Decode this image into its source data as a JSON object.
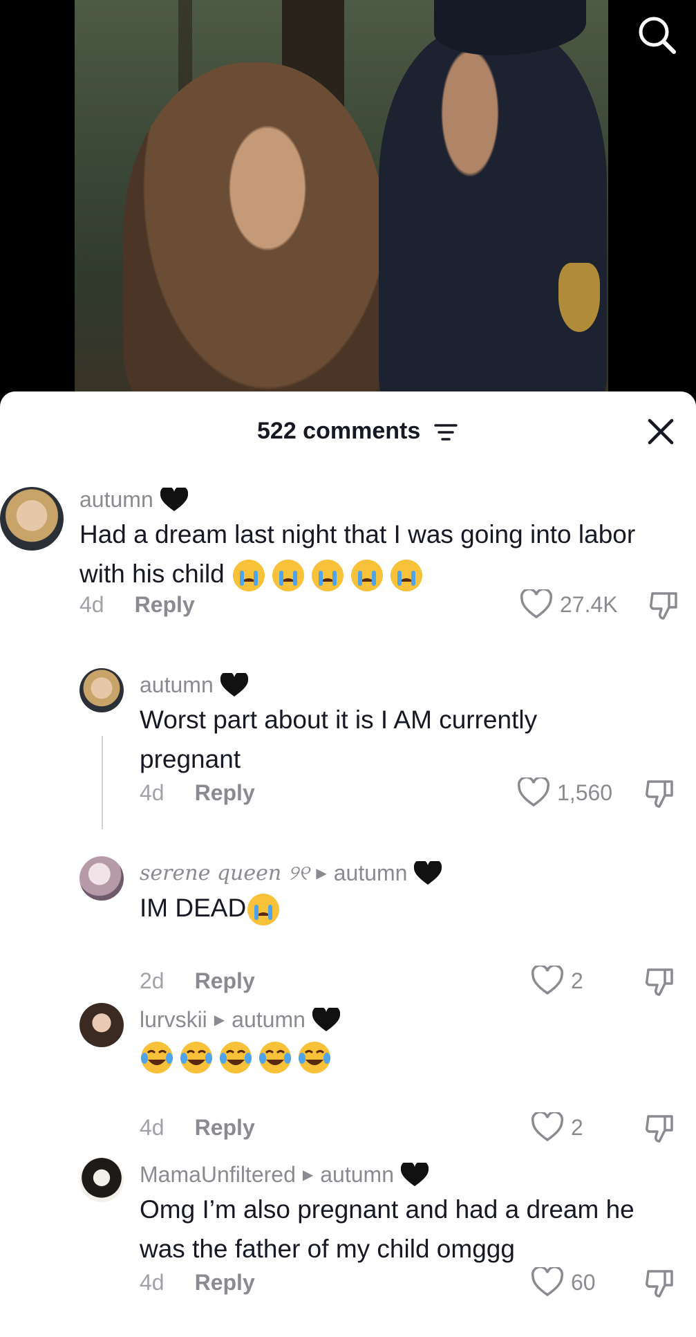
{
  "video": {
    "image_description": "",
    "search_icon": "search-icon"
  },
  "comments_panel": {
    "title": "522 comments",
    "sort_icon": "filter-sort-icon",
    "close_icon": "close-icon"
  },
  "comments": [
    {
      "username": "autumn",
      "reply_to": "",
      "text": "Had a dream last night that I was going into labor with his child",
      "emoji": [
        "crying-face",
        "crying-face",
        "crying-face",
        "crying-face",
        "crying-face"
      ],
      "age": "4d",
      "reply_label": "Reply",
      "likes": "27.4K"
    },
    {
      "username": "autumn",
      "reply_to": "",
      "text": "Worst part about it is I AM currently pregnant",
      "emoji": [],
      "age": "4d",
      "reply_label": "Reply",
      "likes": "1,560"
    },
    {
      "username": "serene queen ୨୧",
      "reply_to": "autumn",
      "text": "IM DEAD",
      "emoji": [
        "crying-face"
      ],
      "age": "2d",
      "reply_label": "Reply",
      "likes": "2"
    },
    {
      "username": "lurvskii",
      "reply_to": "autumn",
      "text": "",
      "emoji": [
        "joy-face",
        "joy-face",
        "joy-face",
        "joy-face",
        "joy-face"
      ],
      "age": "4d",
      "reply_label": "Reply",
      "likes": "2"
    },
    {
      "username": "MamaUnfiltered",
      "reply_to": "autumn",
      "text": "Omg I’m also pregnant and had a dream he was the father of my child omggg",
      "emoji": [],
      "age": "4d",
      "reply_label": "Reply",
      "likes": "60"
    }
  ],
  "colors": {
    "sheet_bg": "#ffffff",
    "text_primary": "#161823",
    "text_secondary": "#8a8b91",
    "text_muted": "#a1a2a7"
  }
}
